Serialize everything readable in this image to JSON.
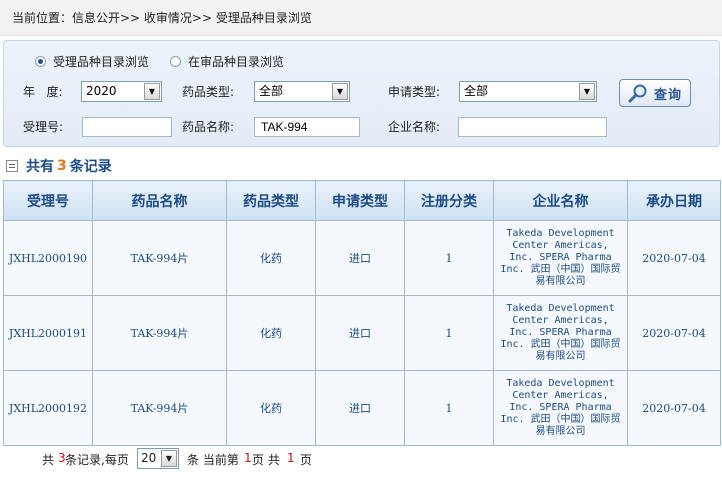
{
  "breadcrumb": "当前位置：信息公开>> 收审情况>> 受理品种目录浏览",
  "search": {
    "radio_browse": "受理品种目录浏览",
    "radio_review": "在审品种目录浏览",
    "year_label": "年   度:",
    "year_value": "2020",
    "drug_type_label": "药品类型:",
    "drug_type_value": "全部",
    "apply_type_label": "申请类型:",
    "apply_type_value": "全部",
    "accept_no_label": "受理号:",
    "accept_no_value": "",
    "drug_name_label": "药品名称:",
    "drug_name_value": "TAK-994",
    "company_label": "企业名称:",
    "company_value": "",
    "query_button": "查询"
  },
  "summary": {
    "prefix": "共有",
    "count": "3",
    "suffix": "条记录"
  },
  "table": {
    "headers": [
      "受理号",
      "药品名称",
      "药品类型",
      "申请类型",
      "注册分类",
      "企业名称",
      "承办日期"
    ],
    "rows": [
      [
        "JXHL2000190",
        "TAK-994片",
        "化药",
        "进口",
        "1",
        "Takeda Development Center Americas, Inc. SPERA Pharma Inc. 武田（中国）国际贸易有限公司",
        "2020-07-04"
      ],
      [
        "JXHL2000191",
        "TAK-994片",
        "化药",
        "进口",
        "1",
        "Takeda Development Center Americas, Inc. SPERA Pharma Inc. 武田（中国）国际贸易有限公司",
        "2020-07-04"
      ],
      [
        "JXHL2000192",
        "TAK-994片",
        "化药",
        "进口",
        "1",
        "Takeda Development Center Americas, Inc. SPERA Pharma Inc. 武田（中国）国际贸易有限公司",
        "2020-07-04"
      ]
    ]
  },
  "pager": {
    "total_prefix": "共",
    "total_count": "3",
    "total_suffix": "条记录,每页",
    "page_size": "20",
    "current_prefix": "条 当前第",
    "current_page": "1",
    "current_suffix": "页 共",
    "total_pages": "1",
    "pages_suffix": "页"
  },
  "colors": {
    "header_text": "#1d4b86",
    "count_orange": "#e07a1f",
    "pager_red": "#d01010"
  }
}
